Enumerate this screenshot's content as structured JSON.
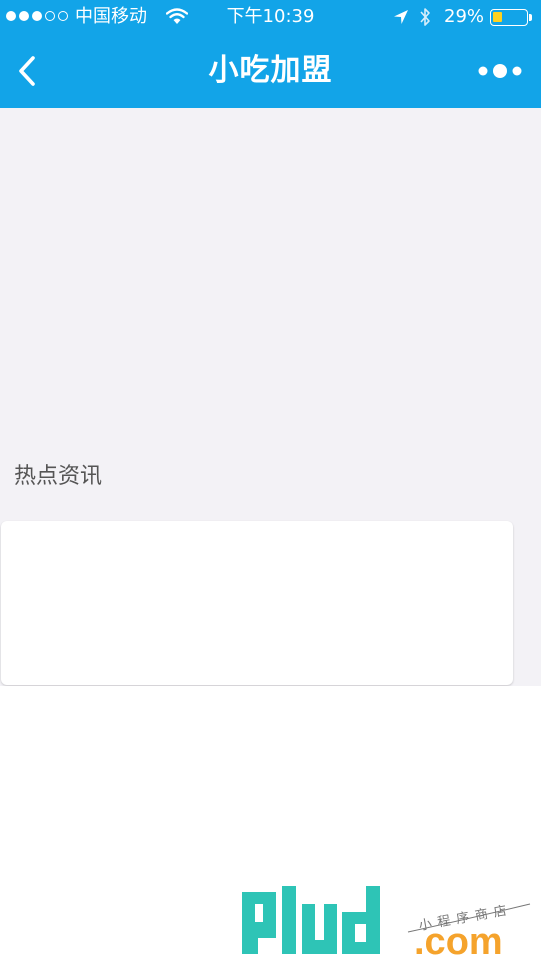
{
  "status_bar": {
    "carrier": "中国移动",
    "time": "下午10:39",
    "battery_percent": "29%",
    "battery_level": 0.29,
    "signal_bars": 3,
    "signal_total": 5
  },
  "nav": {
    "title": "小吃加盟",
    "back_icon": "chevron-left-icon",
    "more_icon": "more-dots-icon"
  },
  "section": {
    "title": "热点资讯"
  },
  "watermark": {
    "logo_text": "91ud",
    "tagline": "小程序商店",
    "domain": ".com"
  },
  "colors": {
    "nav_blue": "#12a4e8",
    "page_bg": "#f3f2f6",
    "battery_fill": "#ffd21f",
    "watermark_teal": "#2ec4b6",
    "watermark_orange": "#f5a32c"
  }
}
